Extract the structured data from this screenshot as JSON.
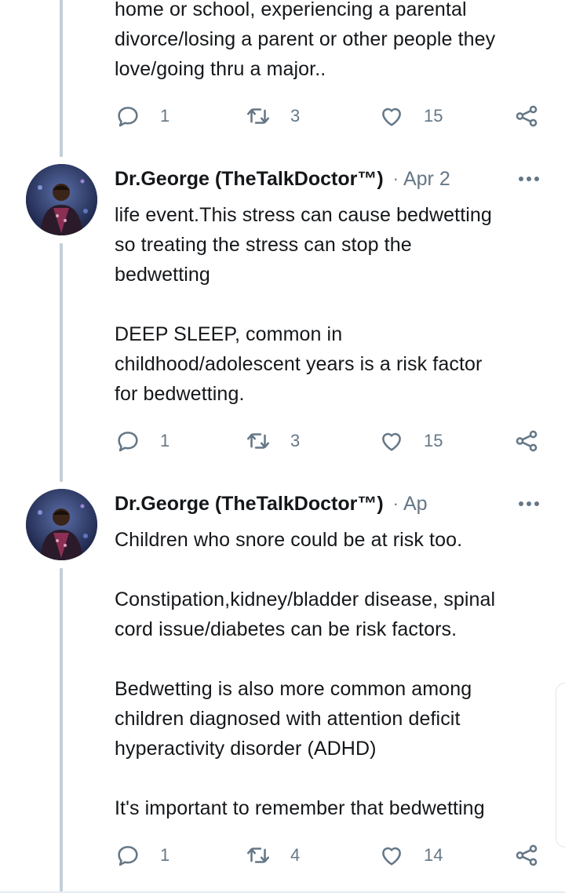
{
  "tweets": [
    {
      "text": "home or school, experiencing a parental\ndivorce/losing a parent or other people they\nlove/going thru a major..",
      "reply_count": "1",
      "retweet_count": "3",
      "like_count": "15"
    },
    {
      "author": "Dr.George (TheTalkDoctor™)",
      "separator": "·",
      "date": "Apr 2",
      "text": "life event.This stress can cause bedwetting\nso treating the stress can stop the\nbedwetting\n\nDEEP SLEEP, common in\nchildhood/adolescent years is a risk factor\nfor bedwetting.",
      "reply_count": "1",
      "retweet_count": "3",
      "like_count": "15"
    },
    {
      "author": "Dr.George (TheTalkDoctor™)",
      "separator": "·",
      "date": "Ap",
      "text": "Children who snore could be at risk too.\n\nConstipation,kidney/bladder disease, spinal\ncord issue/diabetes can be risk factors.\n\nBedwetting is also more common among\nchildren diagnosed with attention deficit\nhyperactivity disorder (ADHD)\n\nIt's important to remember that bedwetting",
      "reply_count": "1",
      "retweet_count": "4",
      "like_count": "14"
    }
  ],
  "icons": {
    "reply": "reply-icon",
    "retweet": "retweet-icon",
    "like": "heart-icon",
    "share": "share-icon",
    "more": "more-options-icon"
  },
  "colors": {
    "text": "#14171a",
    "muted": "#657786",
    "thread_line": "#c4cfd6"
  }
}
